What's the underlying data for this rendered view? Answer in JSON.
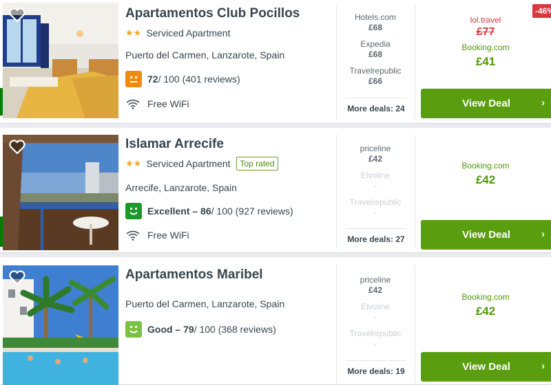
{
  "colors": {
    "accent_green": "#5a9e0f",
    "price_green": "#4e9a06",
    "discount_red": "#d9363e",
    "star": "#f5a623"
  },
  "hotels": [
    {
      "name": "Apartamentos Club Pocillos",
      "type": "Serviced Apartment",
      "stars": "★★",
      "top_rated": "",
      "location": "Puerto del Carmen, Lanzarote, Spain",
      "rating_icon": "neutral-face-icon",
      "rating_bold": "72",
      "rating_rest": " / 100 (401 reviews)",
      "amenity": "Free WiFi",
      "deals": [
        {
          "provider": "Hotels.com",
          "price": "£68"
        },
        {
          "provider": "Expedia",
          "price": "£68"
        },
        {
          "provider": "Travelrepublic",
          "price": "£66"
        }
      ],
      "more_deals": "More deals: 24",
      "discount": "-46%",
      "strike_provider": "lol.travel",
      "strike_price": "£77",
      "best_provider": "Booking.com",
      "best_price": "£41",
      "cta": "View Deal"
    },
    {
      "name": "Islamar Arrecife",
      "type": "Serviced Apartment",
      "stars": "★★",
      "top_rated": "Top rated",
      "location": "Arrecife, Lanzarote, Spain",
      "rating_icon": "happy-face-icon",
      "rating_bold": "Excellent – 86",
      "rating_rest": " / 100 (927 reviews)",
      "amenity": "Free WiFi",
      "deals": [
        {
          "provider": "priceline",
          "price": "£42"
        },
        {
          "provider": "Elvoline",
          "price": "-"
        },
        {
          "provider": "Travelrepublic",
          "price": "-"
        }
      ],
      "more_deals": "More deals: 27",
      "best_provider": "Booking.com",
      "best_price": "£42",
      "cta": "View Deal"
    },
    {
      "name": "Apartamentos Maribel",
      "location": "Puerto del Carmen, Lanzarote, Spain",
      "rating_icon": "happy-face-icon",
      "rating_bold": "Good – 79",
      "rating_rest": " / 100 (368 reviews)",
      "deals": [
        {
          "provider": "priceline",
          "price": "£42"
        },
        {
          "provider": "Elvoline",
          "price": "-"
        },
        {
          "provider": "Travelrepublic",
          "price": "-"
        }
      ],
      "more_deals": "More deals: 19",
      "best_provider": "Booking.com",
      "best_price": "£42",
      "cta": "View Deal"
    }
  ]
}
